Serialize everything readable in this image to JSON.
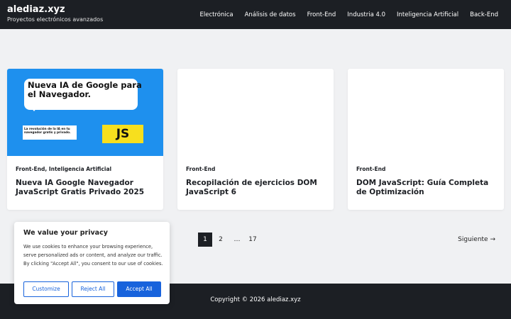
{
  "header": {
    "site_title": "alediaz.xyz",
    "site_description": "Proyectos electrónicos avanzados",
    "nav": [
      "Electrónica",
      "Análisis de datos",
      "Front-End",
      "Industria 4.0",
      "Inteligencia Artificial",
      "Back-End"
    ]
  },
  "cards": [
    {
      "categories": "Front-End, Inteligencia Artificial",
      "title": "Nueva IA Google Navegador JavaScript Gratis Privado 2025",
      "thumbnail": {
        "headline": "Nueva IA de Google para el Navegador.",
        "subtext": "La revolución de la IA en tu navegador gratis y privado.",
        "badge": "JS"
      }
    },
    {
      "categories": "Front-End",
      "title": "Recopilación de ejercicios DOM JavaScript 6"
    },
    {
      "categories": "Front-End",
      "title": "DOM JavaScript: Guía Completa de Optimización"
    }
  ],
  "pagination": {
    "pages": [
      "1",
      "2",
      "…",
      "17"
    ],
    "current": "1",
    "next_label": "Siguiente →"
  },
  "cookie_banner": {
    "title": "We value your privacy",
    "text": "We use cookies to enhance your browsing experience, serve personalized ads or content, and analyze our traffic. By clicking \"Accept All\", you consent to our use of cookies.",
    "customize_label": "Customize",
    "reject_label": "Reject All",
    "accept_label": "Accept All"
  },
  "footer": {
    "copyright": "Copyright © 2026 alediaz.xyz"
  },
  "colors": {
    "header_bg": "#1c1f24",
    "page_bg": "#f0f1f3",
    "accent_blue": "#1863dc",
    "thumbnail_blue": "#1e90ee",
    "js_yellow": "#f7df1e"
  }
}
